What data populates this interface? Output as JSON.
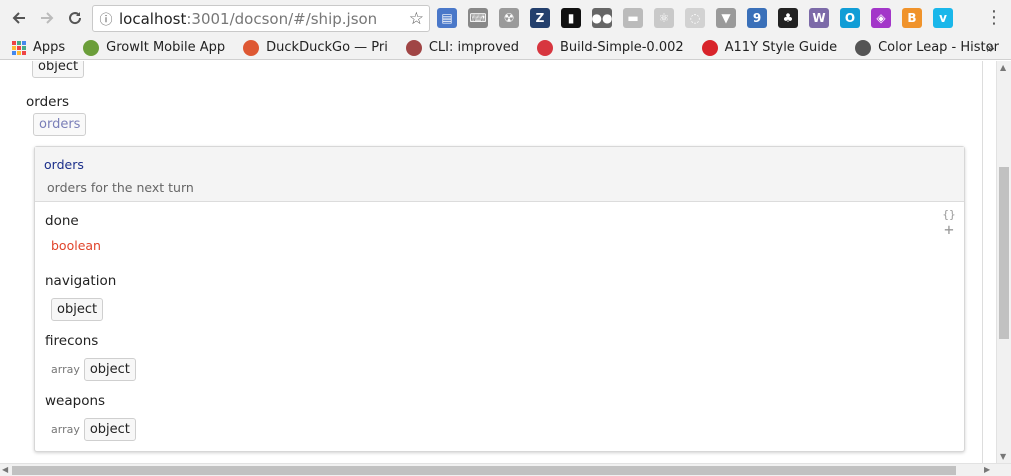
{
  "browser": {
    "url_host": "localhost",
    "url_path": ":3001/docson/#/ship.json",
    "extensions": [
      {
        "name": "extension-1-icon",
        "color": "#4a78c9",
        "glyph": "▤"
      },
      {
        "name": "extension-2-icon",
        "color": "#888888",
        "glyph": "⌨"
      },
      {
        "name": "extension-3-icon",
        "color": "#9a9a9a",
        "glyph": "☢"
      },
      {
        "name": "zotero-icon",
        "color": "#24406d",
        "glyph": "Z"
      },
      {
        "name": "extension-5-icon",
        "color": "#111111",
        "glyph": "▮"
      },
      {
        "name": "extension-6-icon",
        "color": "#666666",
        "glyph": "●●"
      },
      {
        "name": "extension-7-icon",
        "color": "#bbbbbb",
        "glyph": "▬"
      },
      {
        "name": "react-icon",
        "color": "#c9c9c9",
        "glyph": "⚛"
      },
      {
        "name": "extension-9-icon",
        "color": "#d2d2d2",
        "glyph": "◌"
      },
      {
        "name": "vue-icon",
        "color": "#9a9a9a",
        "glyph": "▼"
      },
      {
        "name": "extension-11-icon",
        "color": "#3a70b9",
        "glyph": "9"
      },
      {
        "name": "gnome-icon",
        "color": "#222222",
        "glyph": "♣"
      },
      {
        "name": "extension-13-icon",
        "color": "#7c6aa8",
        "glyph": "W"
      },
      {
        "name": "extension-14-icon",
        "color": "#119dd6",
        "glyph": "O"
      },
      {
        "name": "extension-15-icon",
        "color": "#a336c9",
        "glyph": "◈"
      },
      {
        "name": "bitcoin-icon",
        "color": "#f0932b",
        "glyph": "B"
      },
      {
        "name": "vimeo-icon",
        "color": "#1ab7ea",
        "glyph": "v"
      }
    ],
    "badge": "9"
  },
  "bookmarks": [
    {
      "label": "Apps",
      "icon": "apps-grid-icon",
      "color": "#e44"
    },
    {
      "label": "GrowIt Mobile App",
      "icon": "growit-icon",
      "color": "#6b9e3a"
    },
    {
      "label": "DuckDuckGo — Pri",
      "icon": "duckduckgo-icon",
      "color": "#de5833"
    },
    {
      "label": "CLI: improved",
      "icon": "cli-avatar-icon",
      "color": "#a04545"
    },
    {
      "label": "Build-Simple-0.002",
      "icon": "build-icon",
      "color": "#d7363f"
    },
    {
      "label": "A11Y Style Guide",
      "icon": "a11y-icon",
      "color": "#d8232a"
    },
    {
      "label": "Color Leap - Histor",
      "icon": "colorleap-icon",
      "color": "#555555"
    }
  ],
  "schema": {
    "top_chip": "object",
    "orders_label": "orders",
    "orders_chip": "orders",
    "card": {
      "title": "orders",
      "description": "orders for the next turn",
      "tools_json": "{}",
      "tools_plus": "+",
      "properties": [
        {
          "name": "done",
          "type": "boolean",
          "array": ""
        },
        {
          "name": "navigation",
          "type": "object",
          "array": ""
        },
        {
          "name": "firecons",
          "type": "object",
          "array": "array"
        },
        {
          "name": "weapons",
          "type": "object",
          "array": "array"
        }
      ]
    }
  }
}
